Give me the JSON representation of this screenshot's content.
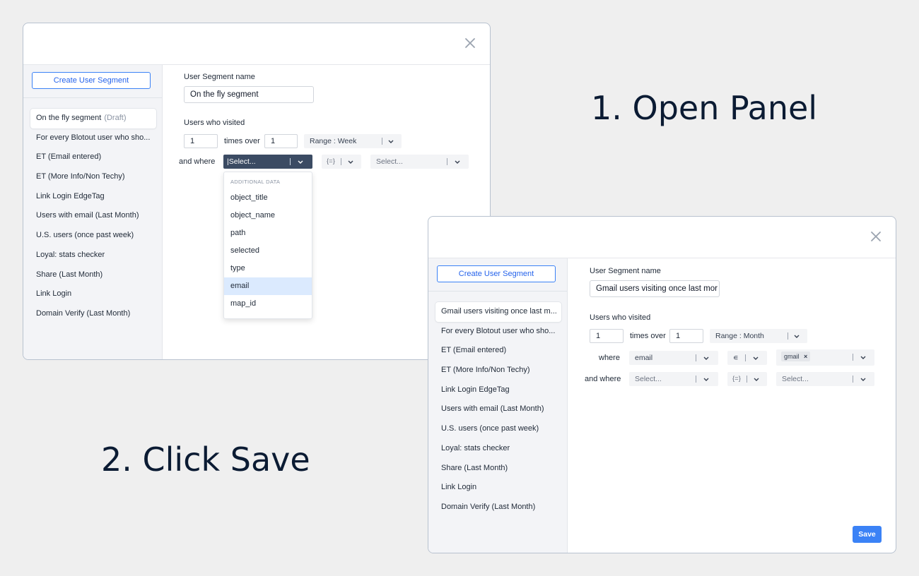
{
  "steps": {
    "step1": "1. Open Panel",
    "step2": "2. Click Save"
  },
  "panel1": {
    "create_label": "Create User Segment",
    "sidebar_items": [
      "On the fly segment",
      "For every Blotout user who sho...",
      "ET (Email entered)",
      "ET (More Info/Non Techy)",
      "Link Login EdgeTag",
      "Users with email (Last Month)",
      "U.S. users (once past week)",
      "Loyal: stats checker",
      "Share (Last Month)",
      "Link Login",
      "Domain Verify (Last Month)"
    ],
    "draft_badge": "(Draft)",
    "segment_name_label": "User Segment name",
    "segment_name_value": "On the fly segment",
    "users_visited_label": "Users who visited",
    "times_value": "1",
    "times_over_label": "times over",
    "over_value": "1",
    "range_value": "Range : Week",
    "and_where_label": "and where",
    "where_select_value": "|Select...",
    "operator_value": "{=}",
    "value_placeholder": "Select...",
    "dropdown_header": "ADDITIONAL DATA",
    "dropdown_items": [
      "object_title",
      "object_name",
      "path",
      "selected",
      "type",
      "email",
      "map_id"
    ],
    "highlighted_item": "email"
  },
  "panel2": {
    "create_label": "Create User Segment",
    "sidebar_items": [
      "Gmail users visiting once last m...",
      "For every Blotout user who sho...",
      "ET (Email entered)",
      "ET (More Info/Non Techy)",
      "Link Login EdgeTag",
      "Users with email (Last Month)",
      "U.S. users (once past week)",
      "Loyal: stats checker",
      "Share (Last Month)",
      "Link Login",
      "Domain Verify (Last Month)"
    ],
    "segment_name_label": "User Segment name",
    "segment_name_value": "Gmail users visiting once last mor",
    "users_visited_label": "Users who visited",
    "times_value": "1",
    "times_over_label": "times over",
    "over_value": "1",
    "range_value": "Range : Month",
    "where_label": "where",
    "where_value": "email",
    "where_operator": "∊",
    "chip_label": "gmail",
    "chip_remove": "×",
    "and_where_label": "and where",
    "select_placeholder": "Select...",
    "operator_value": "{=}",
    "save_label": "Save"
  }
}
